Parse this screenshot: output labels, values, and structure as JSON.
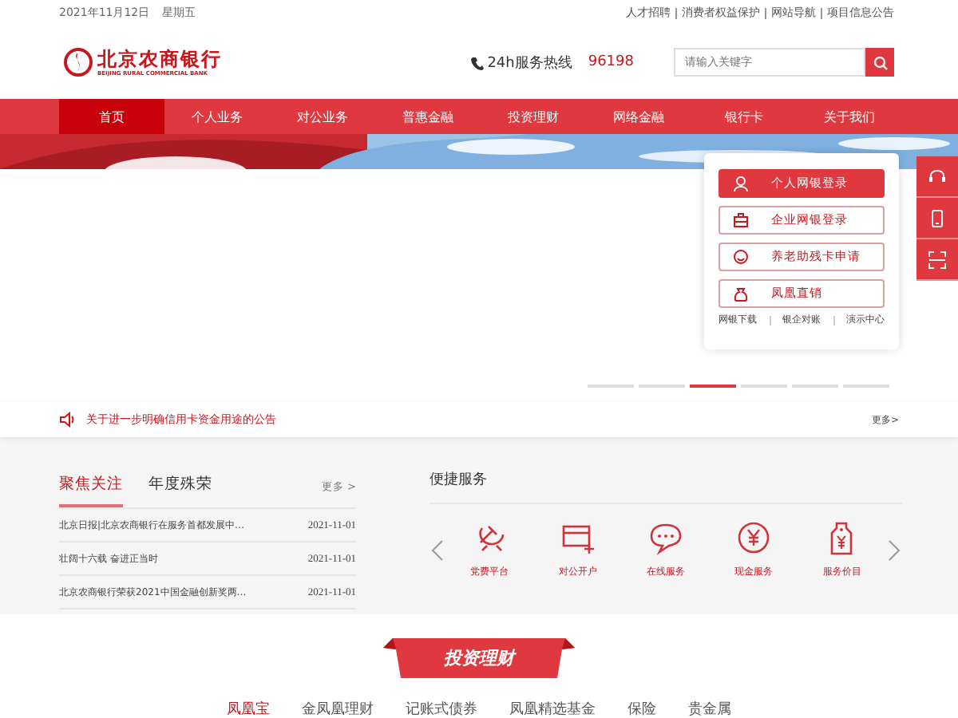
{
  "top_bar": {
    "date": "2021年11月12日",
    "weekday": "星期五",
    "links": [
      "人才招聘",
      "消费者权益保护",
      "网站导航",
      "项目信息公告"
    ]
  },
  "header": {
    "logo_name": "北京农商银行",
    "logo_subtitle": "BEIJING RURAL COMMERCIAL BANK",
    "hotline_label": "24h服务热线",
    "hotline_number": "96198",
    "search": {
      "placeholder": "请输入关键字"
    }
  },
  "nav": [
    {
      "label": "首页",
      "selected": true
    },
    {
      "label": "个人业务",
      "selected": false
    },
    {
      "label": "对公业务",
      "selected": false
    },
    {
      "label": "普惠金融",
      "selected": false
    },
    {
      "label": "投资理财",
      "selected": false
    },
    {
      "label": "网络金融",
      "selected": false
    },
    {
      "label": "银行卡",
      "selected": false
    },
    {
      "label": "关于我们",
      "selected": false
    }
  ],
  "banner": {
    "kind": "picture",
    "slides": [
      {
        "selected": false
      },
      {
        "selected": false
      },
      {
        "selected": true
      },
      {
        "selected": false
      },
      {
        "selected": false
      },
      {
        "selected": false
      }
    ]
  },
  "login_panel": {
    "buttons": [
      {
        "label": "个人网银登录",
        "primary": true
      },
      {
        "label": "企业网银登录",
        "primary": false
      },
      {
        "label": "养老助残卡申请",
        "primary": false
      },
      {
        "label": "凤凰直销",
        "primary": false
      }
    ],
    "links": [
      "网银下载",
      "银企对账",
      "演示中心"
    ]
  },
  "notice": {
    "text": "关于进一步明确信用卡资金用途的公告",
    "more": "更多>"
  },
  "news": {
    "tabs": [
      {
        "label": "聚焦关注",
        "selected": true
      },
      {
        "label": "年度殊荣",
        "selected": false
      }
    ],
    "more": "更多 >",
    "items": [
      {
        "title": "北京日报|北京农商银行在服务首都发展中…",
        "date": "2021-11-01"
      },
      {
        "title": "壮阔十六载 奋进正当时",
        "date": "2021-11-01"
      },
      {
        "title": "北京农商银行荣获2021中国金融创新奖两…",
        "date": "2021-11-01"
      }
    ]
  },
  "services": {
    "title": "便捷服务",
    "items": [
      {
        "label": "党费平台"
      },
      {
        "label": "对公开户"
      },
      {
        "label": "在线服务"
      },
      {
        "label": "现金服务"
      },
      {
        "label": "服务价目"
      }
    ]
  },
  "section_title": "投资理财",
  "product_tabs": [
    {
      "label": "凤凰宝",
      "selected": true
    },
    {
      "label": "金凤凰理财",
      "selected": false
    },
    {
      "label": "记账式债券",
      "selected": false
    },
    {
      "label": "凤凰精选基金",
      "selected": false
    },
    {
      "label": "保险",
      "selected": false
    },
    {
      "label": "贵金属",
      "selected": false
    }
  ]
}
